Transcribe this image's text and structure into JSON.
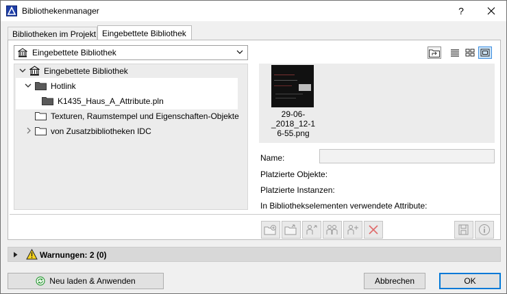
{
  "window": {
    "title": "Bibliothekenmanager",
    "help_label": "?"
  },
  "tabs": [
    {
      "label": "Bibliotheken im Projekt",
      "active": false
    },
    {
      "label": "Eingebettete Bibliothek",
      "active": true
    }
  ],
  "library_select": {
    "selected": "Eingebettete Bibliothek"
  },
  "tree": {
    "items": [
      {
        "label": "Eingebettete Bibliothek",
        "expanded": true,
        "icon": "library-building-icon"
      },
      {
        "label": "Hotlink",
        "expanded": true,
        "icon": "folder-dark-icon"
      },
      {
        "label": "K1435_Haus_A_Attribute.pln",
        "icon": "folder-dark-icon"
      },
      {
        "label": "Texturen, Raumstempel und Eigenschaften-Objekte",
        "icon": "folder-icon"
      },
      {
        "label": "von Zusatzbibliotheken IDC",
        "expanded": false,
        "icon": "folder-icon"
      }
    ]
  },
  "preview": {
    "file_name_line1": "29-06-_2018_12-1",
    "file_name_line2": "6-55.png"
  },
  "properties": {
    "name_label": "Name:",
    "name_value": "",
    "placed_objects_label": "Platzierte Objekte:",
    "placed_instances_label": "Platzierte Instanzen:",
    "attributes_label": "In Bibliothekselementen verwendete Attribute:"
  },
  "warnings": {
    "label": "Warnungen: 2 (0)"
  },
  "footer": {
    "reload_label": "Neu laden & Anwenden",
    "cancel_label": "Abbrechen",
    "ok_label": "OK"
  },
  "colors": {
    "accent": "#0078d7",
    "selection_border": "#3b8de0",
    "delete_red": "#d94040",
    "reload_green": "#2e9b3a"
  }
}
